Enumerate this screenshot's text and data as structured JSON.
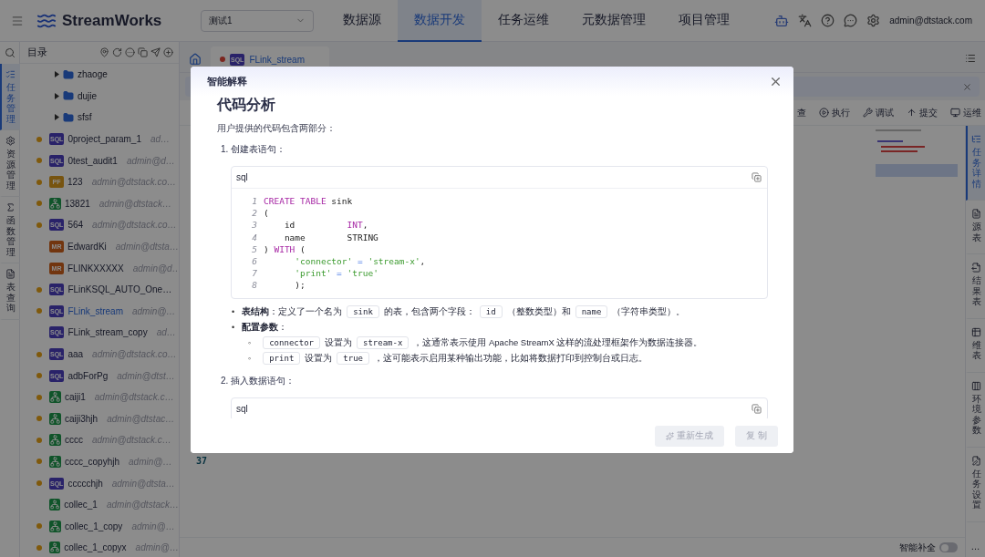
{
  "top_bar": {
    "logo_text": "StreamWorks",
    "project_select": {
      "value": "测试1"
    },
    "nav": [
      {
        "label": "数据源",
        "selected": false
      },
      {
        "label": "数据开发",
        "selected": true
      },
      {
        "label": "任务运维",
        "selected": false
      },
      {
        "label": "元数据管理",
        "selected": false
      },
      {
        "label": "项目管理",
        "selected": false
      }
    ],
    "user": "admin@dtstack.com"
  },
  "left_rail": {
    "items": [
      {
        "label": "任务管理",
        "selected": true
      },
      {
        "label": "资源管理",
        "selected": false
      },
      {
        "label": "函数管理",
        "selected": false
      },
      {
        "label": "表查询",
        "selected": false
      }
    ]
  },
  "tree": {
    "title": "目录",
    "folders": [
      {
        "name": "zhaoge"
      },
      {
        "name": "dujie"
      },
      {
        "name": "sfsf"
      }
    ],
    "tasks": [
      {
        "name": "0project_param_1",
        "owner": "ad…",
        "dot": true,
        "kind": "sql",
        "badge": "SQL",
        "selected": false
      },
      {
        "name": "0test_audit1",
        "owner": "admin@d…",
        "dot": true,
        "kind": "sql",
        "badge": "SQL",
        "selected": false
      },
      {
        "name": "123",
        "owner": "admin@dtstack.co…",
        "dot": true,
        "kind": "pf",
        "badge": "PF",
        "selected": false
      },
      {
        "name": "13821",
        "owner": "admin@dtstack…",
        "dot": true,
        "kind": "flow",
        "selected": false
      },
      {
        "name": "564",
        "owner": "admin@dtstack.co…",
        "dot": true,
        "kind": "sql",
        "badge": "SQL",
        "selected": false
      },
      {
        "name": "EdwardKi",
        "owner": "admin@dtsta…",
        "dot": false,
        "kind": "mr",
        "badge": "MR",
        "selected": false
      },
      {
        "name": "FLINKXXXXX",
        "owner": "admin@d…",
        "dot": false,
        "kind": "mr",
        "badge": "MR",
        "selected": false
      },
      {
        "name": "FLinKSQL_AUTO_One…",
        "dot": true,
        "kind": "sql",
        "badge": "SQL",
        "selected": false
      },
      {
        "name": "FLink_stream",
        "owner": "admin@…",
        "dot": true,
        "kind": "sql",
        "badge": "SQL",
        "selected": true
      },
      {
        "name": "FLink_stream_copy",
        "owner": "ad…",
        "dot": false,
        "kind": "sql",
        "badge": "SQL",
        "selected": false
      },
      {
        "name": "aaa",
        "owner": "admin@dtstack.co…",
        "dot": true,
        "kind": "sql",
        "badge": "SQL",
        "selected": false
      },
      {
        "name": "adbForPg",
        "owner": "admin@dtst…",
        "dot": true,
        "kind": "sql",
        "badge": "SQL",
        "selected": false
      },
      {
        "name": "caiji1",
        "owner": "admin@dtstack.c…",
        "dot": true,
        "kind": "flow",
        "selected": false
      },
      {
        "name": "caiji3hjh",
        "owner": "admin@dtstac…",
        "dot": true,
        "kind": "flow",
        "selected": false
      },
      {
        "name": "cccc",
        "owner": "admin@dtstack.c…",
        "dot": true,
        "kind": "flow",
        "selected": false
      },
      {
        "name": "cccc_copyhjh",
        "owner": "admin@…",
        "dot": true,
        "kind": "flow",
        "selected": false
      },
      {
        "name": "ccccchjh",
        "owner": "admin@dtsta…",
        "dot": true,
        "kind": "sql",
        "badge": "SQL",
        "selected": false
      },
      {
        "name": "collec_1",
        "owner": "admin@dtstack…",
        "dot": false,
        "kind": "flow",
        "selected": false
      },
      {
        "name": "collec_1_copy",
        "owner": "admin@…",
        "dot": true,
        "kind": "flow",
        "selected": false
      },
      {
        "name": "collec_1_copyx",
        "owner": "admin@…",
        "dot": true,
        "kind": "flow",
        "selected": false
      }
    ]
  },
  "editor_tab": {
    "label": "FLink_stream",
    "badge": "SQL",
    "modified": true
  },
  "toolbar": [
    "查",
    "执行",
    "调试",
    "提交",
    "运维"
  ],
  "editor": {
    "line_number": "37"
  },
  "right_rail": {
    "items": [
      {
        "label": "任务详情",
        "selected": true
      },
      {
        "label": "源表",
        "selected": false
      },
      {
        "label": "结果表",
        "selected": false
      },
      {
        "label": "维表",
        "selected": false
      },
      {
        "label": "环境参数",
        "selected": false
      },
      {
        "label": "任务设置",
        "selected": false
      }
    ],
    "more": "…"
  },
  "bottom_bar": {
    "autocomplete": {
      "label": "智能补全",
      "on": false
    }
  },
  "modal": {
    "title": "智能解释",
    "heading": "代码分析",
    "intro": "用户提供的代码包含两部分：",
    "steps": [
      {
        "label": "1. 创建表语句：",
        "code": {
          "lang": "sql",
          "lines": [
            {
              "n": "1",
              "tokens": [
                {
                  "t": "CREATE TABLE",
                  "kind": "keyword"
                },
                {
                  "t": " sink",
                  "kind": "plain"
                }
              ]
            },
            {
              "n": "2",
              "tokens": [
                {
                  "t": "(",
                  "kind": "plain"
                }
              ]
            },
            {
              "n": "3",
              "tokens": [
                {
                  "t": "    id          ",
                  "kind": "plain"
                },
                {
                  "t": "INT",
                  "kind": "keyword"
                },
                {
                  "t": ",",
                  "kind": "plain"
                }
              ]
            },
            {
              "n": "4",
              "tokens": [
                {
                  "t": "    name        STRING",
                  "kind": "plain"
                }
              ]
            },
            {
              "n": "5",
              "tokens": [
                {
                  "t": ") ",
                  "kind": "plain"
                },
                {
                  "t": "WITH",
                  "kind": "keyword"
                },
                {
                  "t": " (",
                  "kind": "plain"
                }
              ]
            },
            {
              "n": "6",
              "tokens": [
                {
                  "t": "      'connector'",
                  "kind": "string"
                },
                {
                  "t": " = ",
                  "kind": "operator"
                },
                {
                  "t": "'stream-x'",
                  "kind": "string"
                },
                {
                  "t": ",",
                  "kind": "plain"
                }
              ]
            },
            {
              "n": "7",
              "tokens": [
                {
                  "t": "      'print'",
                  "kind": "string"
                },
                {
                  "t": " = ",
                  "kind": "operator"
                },
                {
                  "t": "'true'",
                  "kind": "string"
                }
              ]
            },
            {
              "n": "8",
              "tokens": [
                {
                  "t": "      );",
                  "kind": "plain"
                }
              ]
            }
          ]
        },
        "bullets": [
          {
            "marker": "•",
            "parts": [
              {
                "t": "表结构",
                "kind": "bold"
              },
              {
                "t": "：定义了一个名为",
                "kind": "plain"
              },
              {
                "t": "sink",
                "kind": "code"
              },
              {
                "t": "的表，包含两个字段：",
                "kind": "plain"
              },
              {
                "t": "id",
                "kind": "code"
              },
              {
                "t": "（整数类型）和",
                "kind": "plain"
              },
              {
                "t": "name",
                "kind": "code"
              },
              {
                "t": "（字符串类型）。",
                "kind": "plain"
              }
            ]
          },
          {
            "marker": "•",
            "parts": [
              {
                "t": "配置参数",
                "kind": "bold"
              },
              {
                "t": "：",
                "kind": "plain"
              }
            ],
            "children": [
              {
                "marker": "◦",
                "parts": [
                  {
                    "t": "connector",
                    "kind": "code"
                  },
                  {
                    "t": "设置为",
                    "kind": "plain"
                  },
                  {
                    "t": "stream-x",
                    "kind": "code"
                  },
                  {
                    "t": "，这通常表示使用 Apache StreamX 这样的流处理框架作为数据连接器。",
                    "kind": "plain"
                  }
                ]
              },
              {
                "marker": "◦",
                "parts": [
                  {
                    "t": "print",
                    "kind": "code"
                  },
                  {
                    "t": "设置为",
                    "kind": "plain"
                  },
                  {
                    "t": "true",
                    "kind": "code"
                  },
                  {
                    "t": "，这可能表示启用某种输出功能，比如将数据打印到控制台或日志。",
                    "kind": "plain"
                  }
                ]
              }
            ]
          }
        ]
      },
      {
        "label": "2. 插入数据语句：",
        "code": {
          "lang": "sql"
        }
      }
    ],
    "buttons": [
      {
        "label": "重新生成",
        "kind": "regenerate",
        "disabled": true
      },
      {
        "label": "复 制",
        "kind": "copy",
        "disabled": true
      }
    ]
  }
}
